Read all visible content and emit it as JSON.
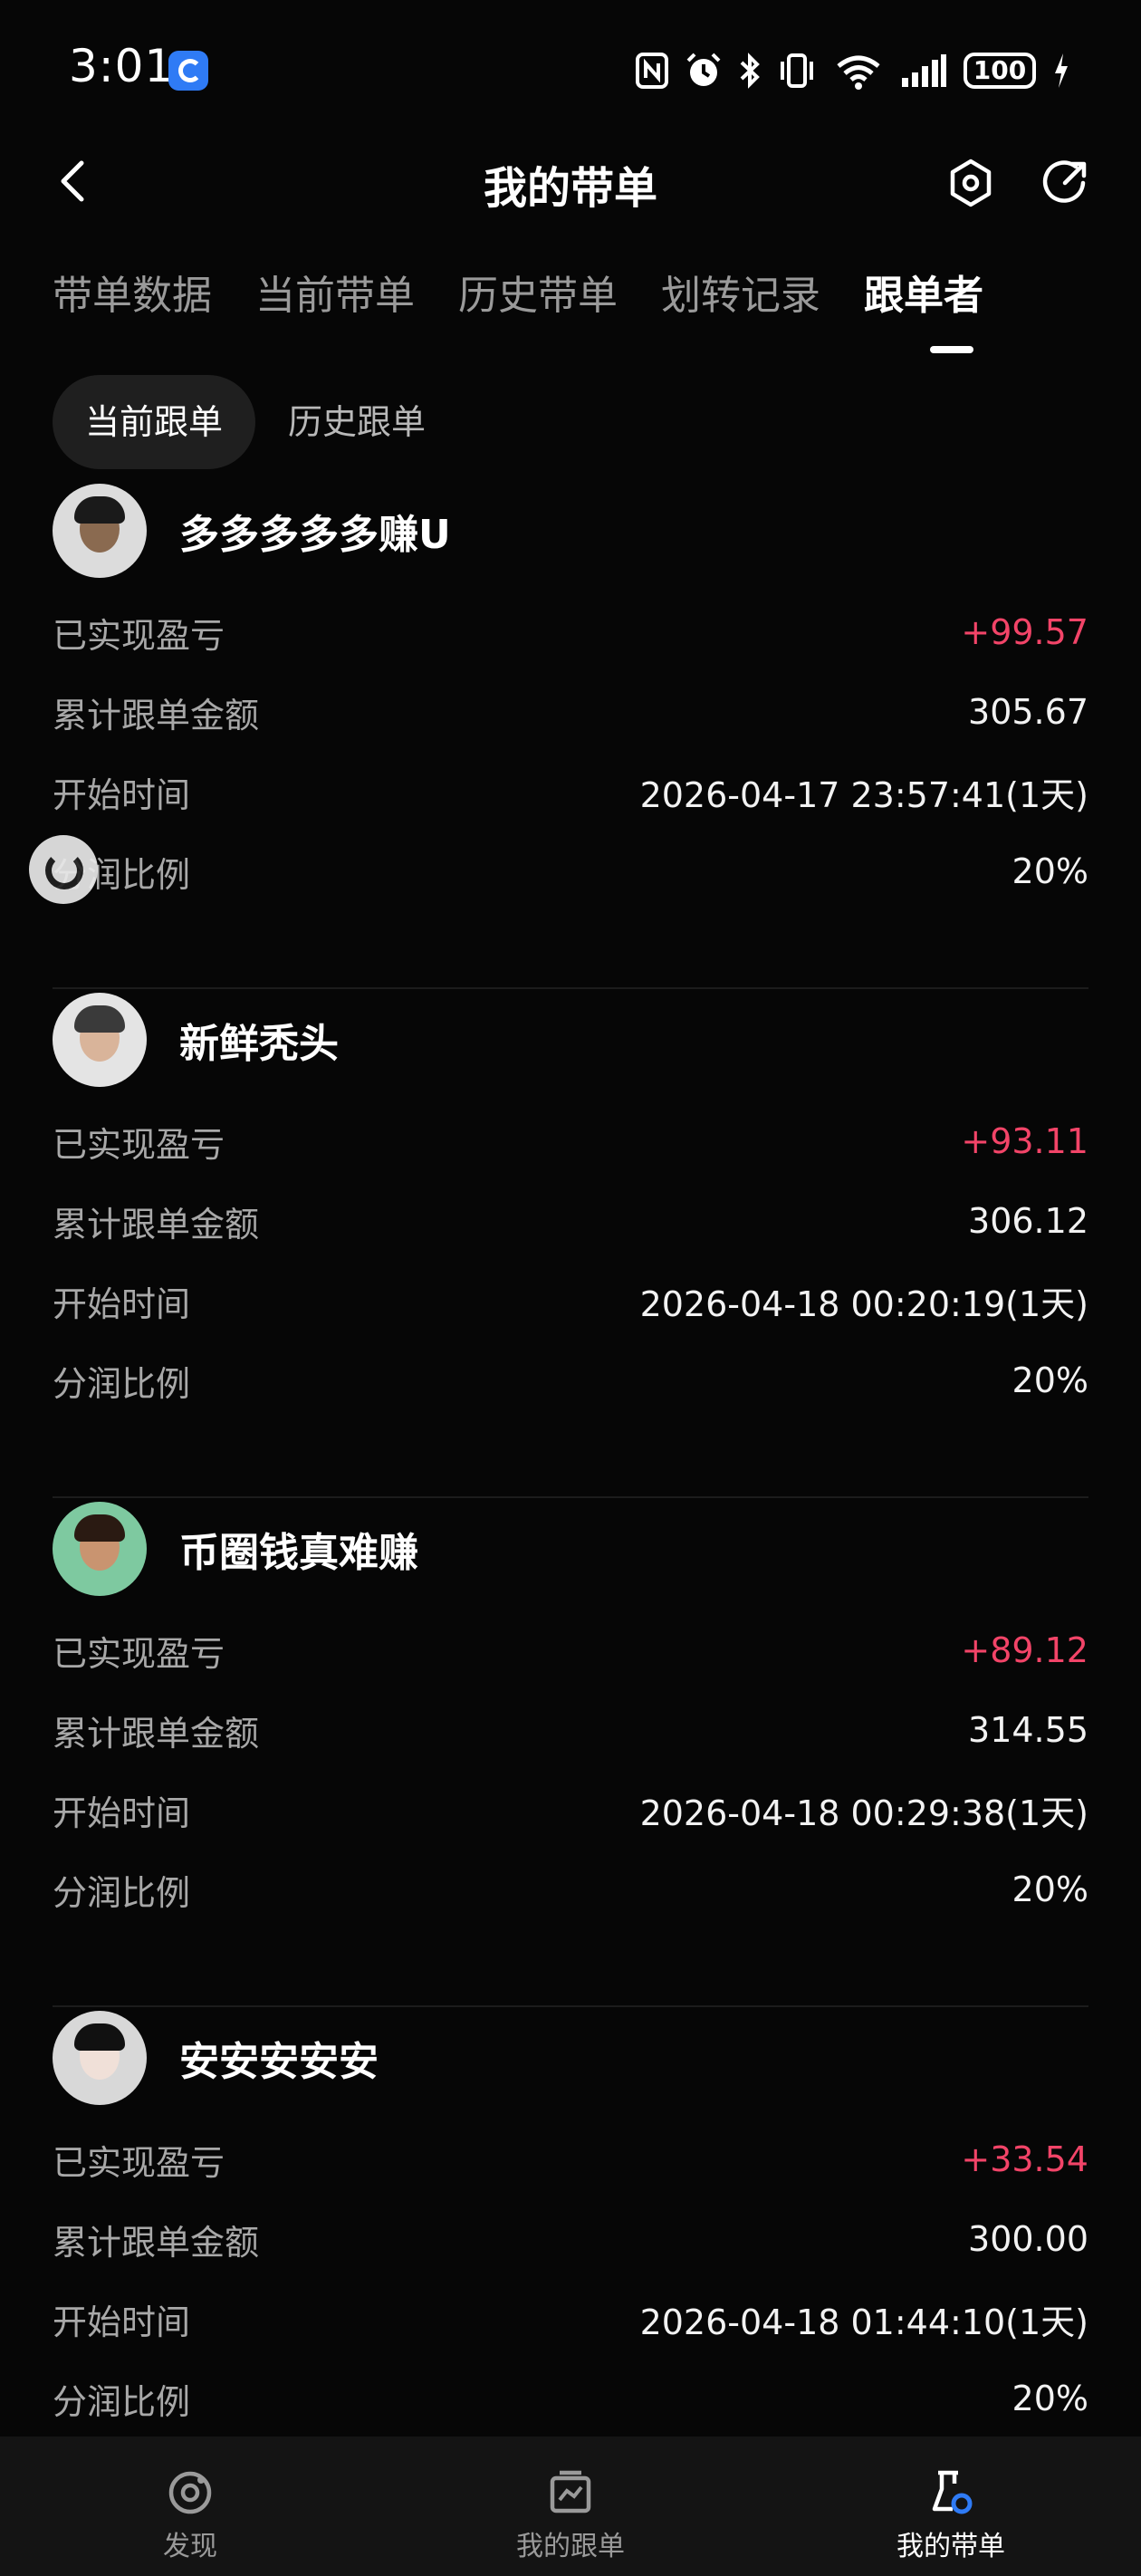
{
  "status_bar": {
    "time": "3:01",
    "battery": "100"
  },
  "header": {
    "title": "我的带单"
  },
  "tabs": [
    {
      "label": "带单数据"
    },
    {
      "label": "当前带单"
    },
    {
      "label": "历史带单"
    },
    {
      "label": "划转记录"
    },
    {
      "label": "跟单者"
    }
  ],
  "subtabs": [
    {
      "label": "当前跟单"
    },
    {
      "label": "历史跟单"
    }
  ],
  "labels": {
    "pnl": "已实现盈亏",
    "amount": "累计跟单金额",
    "start": "开始时间",
    "ratio": "分润比例"
  },
  "followers": [
    {
      "name": "多多多多多赚U",
      "pnl": "+99.57",
      "amount": "305.67",
      "start": "2026-04-17 23:57:41(1天)",
      "ratio": "20%"
    },
    {
      "name": "新鲜秃头",
      "pnl": "+93.11",
      "amount": "306.12",
      "start": "2026-04-18 00:20:19(1天)",
      "ratio": "20%"
    },
    {
      "name": "币圈钱真难赚",
      "pnl": "+89.12",
      "amount": "314.55",
      "start": "2026-04-18 00:29:38(1天)",
      "ratio": "20%"
    },
    {
      "name": "安安安安安",
      "pnl": "+33.54",
      "amount": "300.00",
      "start": "2026-04-18 01:44:10(1天)",
      "ratio": "20%"
    }
  ],
  "bottom_nav": [
    {
      "label": "发现",
      "icon": "discover-icon"
    },
    {
      "label": "我的跟单",
      "icon": "copy-trade-icon"
    },
    {
      "label": "我的带单",
      "icon": "lead-trade-icon"
    }
  ],
  "colors": {
    "positive": "#f24468",
    "accent": "#2f7bf5",
    "background": "#060606"
  }
}
